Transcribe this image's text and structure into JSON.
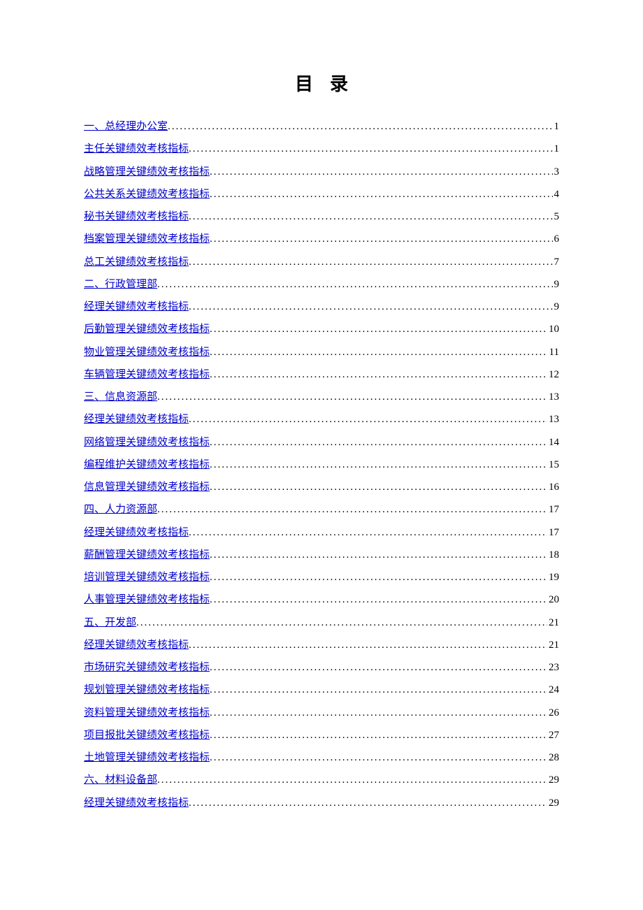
{
  "title": "目录",
  "entries": [
    {
      "label": "一、总经理办公室",
      "page": "1"
    },
    {
      "label": "主任关键绩效考核指标",
      "page": "1"
    },
    {
      "label": "战略管理关键绩效考核指标",
      "page": "3"
    },
    {
      "label": "公共关系关键绩效考核指标",
      "page": "4"
    },
    {
      "label": "秘书关键绩效考核指标",
      "page": "5"
    },
    {
      "label": "档案管理关键绩效考核指标",
      "page": "6"
    },
    {
      "label": "总工关键绩效考核指标",
      "page": "7"
    },
    {
      "label": "二、行政管理部",
      "page": "9"
    },
    {
      "label": "经理关键绩效考核指标",
      "page": "9"
    },
    {
      "label": "后勤管理关键绩效考核指标",
      "page": "10"
    },
    {
      "label": "物业管理关键绩效考核指标",
      "page": "11"
    },
    {
      "label": "车辆管理关键绩效考核指标",
      "page": "12"
    },
    {
      "label": "三、信息资源部",
      "page": "13"
    },
    {
      "label": "经理关键绩效考核指标",
      "page": "13"
    },
    {
      "label": "网络管理关键绩效考核指标",
      "page": "14"
    },
    {
      "label": "编程维护关键绩效考核指标",
      "page": "15"
    },
    {
      "label": "信息管理关键绩效考核指标",
      "page": "16"
    },
    {
      "label": "四、人力资源部",
      "page": "17"
    },
    {
      "label": "经理关键绩效考核指标",
      "page": "17"
    },
    {
      "label": "薪酬管理关键绩效考核指标",
      "page": "18"
    },
    {
      "label": "培训管理关键绩效考核指标",
      "page": "19"
    },
    {
      "label": "人事管理关键绩效考核指标",
      "page": "20"
    },
    {
      "label": "五、开发部",
      "page": "21"
    },
    {
      "label": "经理关键绩效考核指标",
      "page": "21"
    },
    {
      "label": "市场研究关键绩效考核指标",
      "page": "23"
    },
    {
      "label": "规划管理关键绩效考核指标",
      "page": "24"
    },
    {
      "label": "资料管理关键绩效考核指标",
      "page": "26"
    },
    {
      "label": "项目报批关键绩效考核指标",
      "page": "27"
    },
    {
      "label": "土地管理关键绩效考核指标",
      "page": "28"
    },
    {
      "label": "六、材料设备部",
      "page": "29"
    },
    {
      "label": "经理关键绩效考核指标",
      "page": "29"
    }
  ]
}
